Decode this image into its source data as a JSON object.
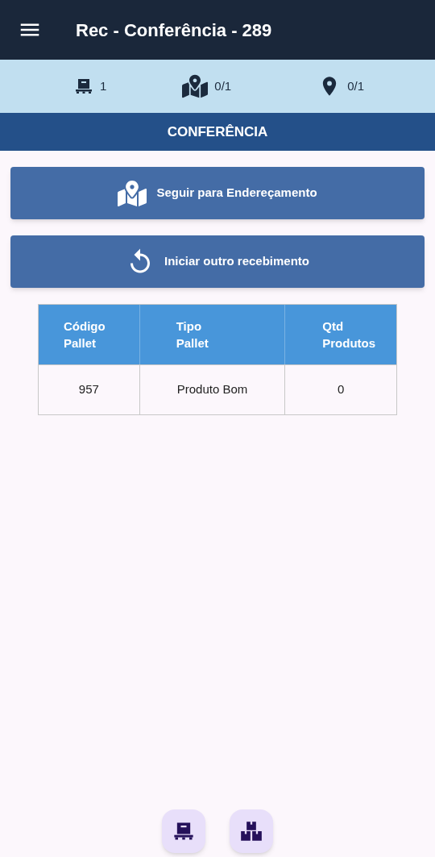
{
  "app_bar": {
    "title": "Rec - Conferência - 289"
  },
  "stats": [
    {
      "kind": "pallet",
      "value": "1"
    },
    {
      "kind": "map",
      "value": "0/1"
    },
    {
      "kind": "pin",
      "value": "0/1"
    }
  ],
  "section_title": "CONFERÊNCIA",
  "buttons": [
    {
      "kind": "map",
      "label": "Seguir para Endereçamento"
    },
    {
      "kind": "restart",
      "label": "Iniciar outro recebimento"
    }
  ],
  "table": {
    "columns": [
      "Código\nPallet",
      "Tipo\nPallet",
      "Qtd\nProdutos"
    ],
    "rows": [
      [
        "957",
        "Produto Bom",
        "0"
      ]
    ]
  },
  "bottom_actions": [
    {
      "kind": "pallet"
    },
    {
      "kind": "boxes"
    }
  ]
}
